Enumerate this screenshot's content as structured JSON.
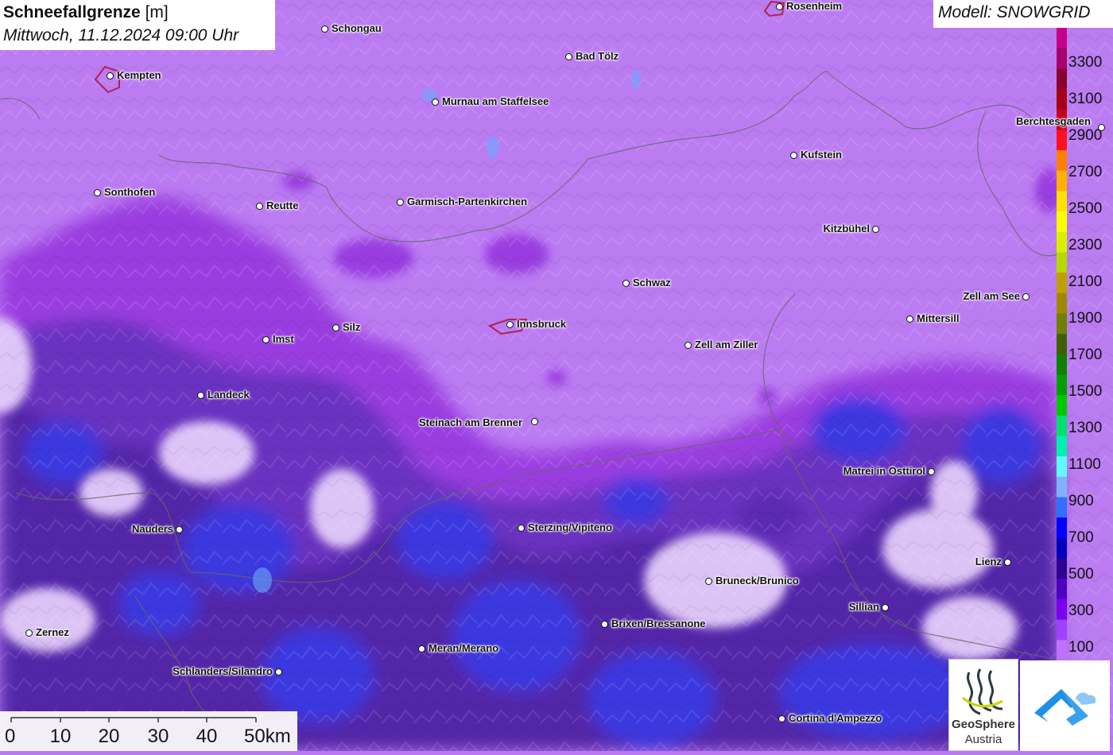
{
  "title": {
    "main": "Schneefallgrenze",
    "unit": "[m]",
    "datetime": "Mittwoch, 11.12.2024 09:00 Uhr"
  },
  "model": "Modell: SNOWGRID",
  "legend": {
    "labels": [
      "3300",
      "3100",
      "2900",
      "2700",
      "2500",
      "2300",
      "2100",
      "1900",
      "1700",
      "1500",
      "1300",
      "1100",
      "900",
      "700",
      "500",
      "300",
      "100"
    ],
    "colors": [
      "#c6008a",
      "#a8006e",
      "#8a0030",
      "#a50018",
      "#c80020",
      "#ff1020",
      "#ff8000",
      "#ffb000",
      "#ffe000",
      "#f8ff00",
      "#d8f000",
      "#b8d800",
      "#c0a000",
      "#a08800",
      "#708000",
      "#406000",
      "#108000",
      "#00a000",
      "#00c800",
      "#00e070",
      "#00f0b0",
      "#60f8f8",
      "#80b0ff",
      "#3070ff",
      "#0000ff",
      "#0000c0",
      "#300090",
      "#5000c0",
      "#7a00f0",
      "#a040ff",
      "#c070ff"
    ]
  },
  "cities": [
    {
      "name": "Rosenheim"
    },
    {
      "name": "Schongau"
    },
    {
      "name": "Bad Tölz"
    },
    {
      "name": "Kempten"
    },
    {
      "name": "Murnau am Staffelsee"
    },
    {
      "name": "Berchtesgaden"
    },
    {
      "name": "Kufstein"
    },
    {
      "name": "Sonthofen"
    },
    {
      "name": "Reutte"
    },
    {
      "name": "Garmisch-Partenkirchen"
    },
    {
      "name": "Kitzbühel"
    },
    {
      "name": "Schwaz"
    },
    {
      "name": "Zell am See"
    },
    {
      "name": "Mittersill"
    },
    {
      "name": "Imst"
    },
    {
      "name": "Silz"
    },
    {
      "name": "Innsbruck"
    },
    {
      "name": "Zell am Ziller"
    },
    {
      "name": "Landeck"
    },
    {
      "name": "Steinach am Brenner"
    },
    {
      "name": "Matrei in Osttirol"
    },
    {
      "name": "Nauders"
    },
    {
      "name": "Sterzing/Vipiteno"
    },
    {
      "name": "Lienz"
    },
    {
      "name": "Bruneck/Brunico"
    },
    {
      "name": "Sillian"
    },
    {
      "name": "Zernez"
    },
    {
      "name": "Brixen/Bressanone"
    },
    {
      "name": "Meran/Merano"
    },
    {
      "name": "Schlanders/Silandro"
    },
    {
      "name": "Cortina d'Ampezzo"
    }
  ],
  "scale": {
    "ticks": [
      "0",
      "10",
      "20",
      "30",
      "40",
      "50km"
    ]
  },
  "logos": {
    "geosphere_line1": "GeoSphere",
    "geosphere_line2": "Austria"
  },
  "colors": {
    "base": "#b978f0",
    "light": "#e0c8f8",
    "purple": "#9a3ee0",
    "dark": "#5a2ab0",
    "blue": "#3a3ae8"
  }
}
